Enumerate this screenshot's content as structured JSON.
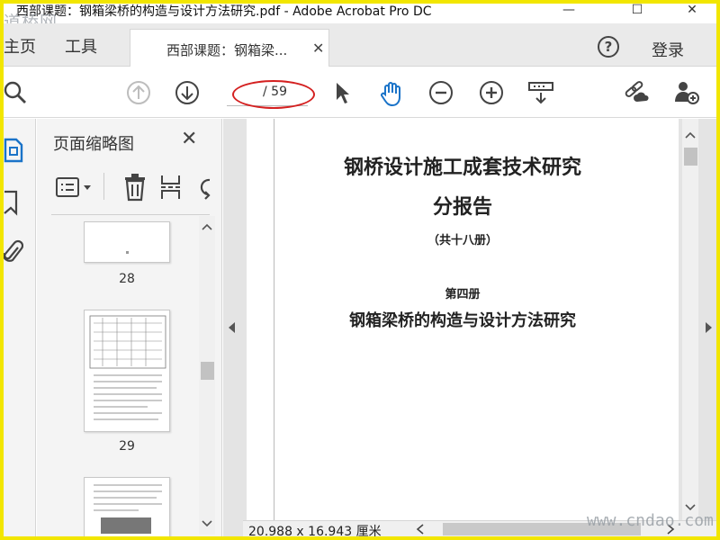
{
  "window": {
    "title": "西部课题：钢箱梁桥的构造与设计方法研究.pdf - Adobe Acrobat Pro DC",
    "watermark_top": "道桥网",
    "minimize": "—",
    "maximize": "☐",
    "close": "✕"
  },
  "tabs": {
    "home": "主页",
    "tools": "工具",
    "document": "西部课题：钢箱梁...",
    "document_close": "✕",
    "help": "?",
    "login": "登录"
  },
  "toolbar": {
    "page_total": "/ 59",
    "annotation_color": "#d42020",
    "accent": "#1a73c8"
  },
  "thumbnails_panel": {
    "title": "页面缩略图",
    "close": "✕",
    "pages": [
      {
        "number": "28"
      },
      {
        "number": "29"
      },
      {
        "number": ""
      }
    ]
  },
  "document": {
    "lines": [
      "钢桥设计施工成套技术研究",
      "分报告",
      "（共十八册）",
      "第四册",
      "钢箱梁桥的构造与设计方法研究"
    ]
  },
  "status": {
    "dimensions": "20.988 x 16.943 厘米",
    "watermark_bottom": "www.cndao.com"
  }
}
